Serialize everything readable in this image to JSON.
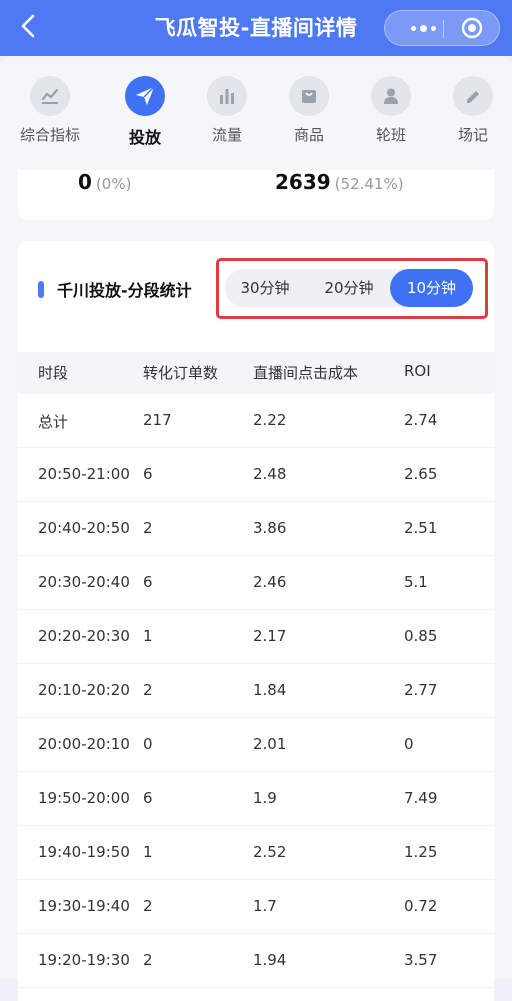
{
  "header": {
    "back_icon": "chevron-left-icon",
    "title": "飞瓜智投-直播间详情",
    "capsule": {
      "more_icon": "more-dots-icon",
      "close_icon": "target-icon"
    }
  },
  "tabs": [
    {
      "label": "综合指标",
      "icon": "line-chart-icon",
      "active": false
    },
    {
      "label": "投放",
      "icon": "paper-plane-icon",
      "active": true
    },
    {
      "label": "流量",
      "icon": "bar-chart-icon",
      "active": false
    },
    {
      "label": "商品",
      "icon": "shopping-bag-icon",
      "active": false
    },
    {
      "label": "轮班",
      "icon": "person-icon",
      "active": false
    },
    {
      "label": "场记",
      "icon": "pencil-icon",
      "active": false
    }
  ],
  "summary": {
    "left_value": "0",
    "left_pct": "(0%)",
    "right_value": "2639",
    "right_pct": "(52.41%)"
  },
  "section": {
    "title": "千川投放-分段统计",
    "segments": [
      "30分钟",
      "20分钟",
      "10分钟"
    ],
    "selected": "10分钟"
  },
  "table": {
    "headers": [
      "时段",
      "转化订单数",
      "直播间点击成本",
      "ROI"
    ],
    "rows": [
      [
        "总计",
        "217",
        "2.22",
        "2.74"
      ],
      [
        "20:50-21:00",
        "6",
        "2.48",
        "2.65"
      ],
      [
        "20:40-20:50",
        "2",
        "3.86",
        "2.51"
      ],
      [
        "20:30-20:40",
        "6",
        "2.46",
        "5.1"
      ],
      [
        "20:20-20:30",
        "1",
        "2.17",
        "0.85"
      ],
      [
        "20:10-20:20",
        "2",
        "1.84",
        "2.77"
      ],
      [
        "20:00-20:10",
        "0",
        "2.01",
        "0"
      ],
      [
        "19:50-20:00",
        "6",
        "1.9",
        "7.49"
      ],
      [
        "19:40-19:50",
        "1",
        "2.52",
        "1.25"
      ],
      [
        "19:30-19:40",
        "2",
        "1.7",
        "0.72"
      ],
      [
        "19:20-19:30",
        "2",
        "1.94",
        "3.57"
      ]
    ]
  },
  "colors": {
    "brand": "#4f79f3",
    "accent": "#3f72f2",
    "highlight": "#e03c3c"
  }
}
